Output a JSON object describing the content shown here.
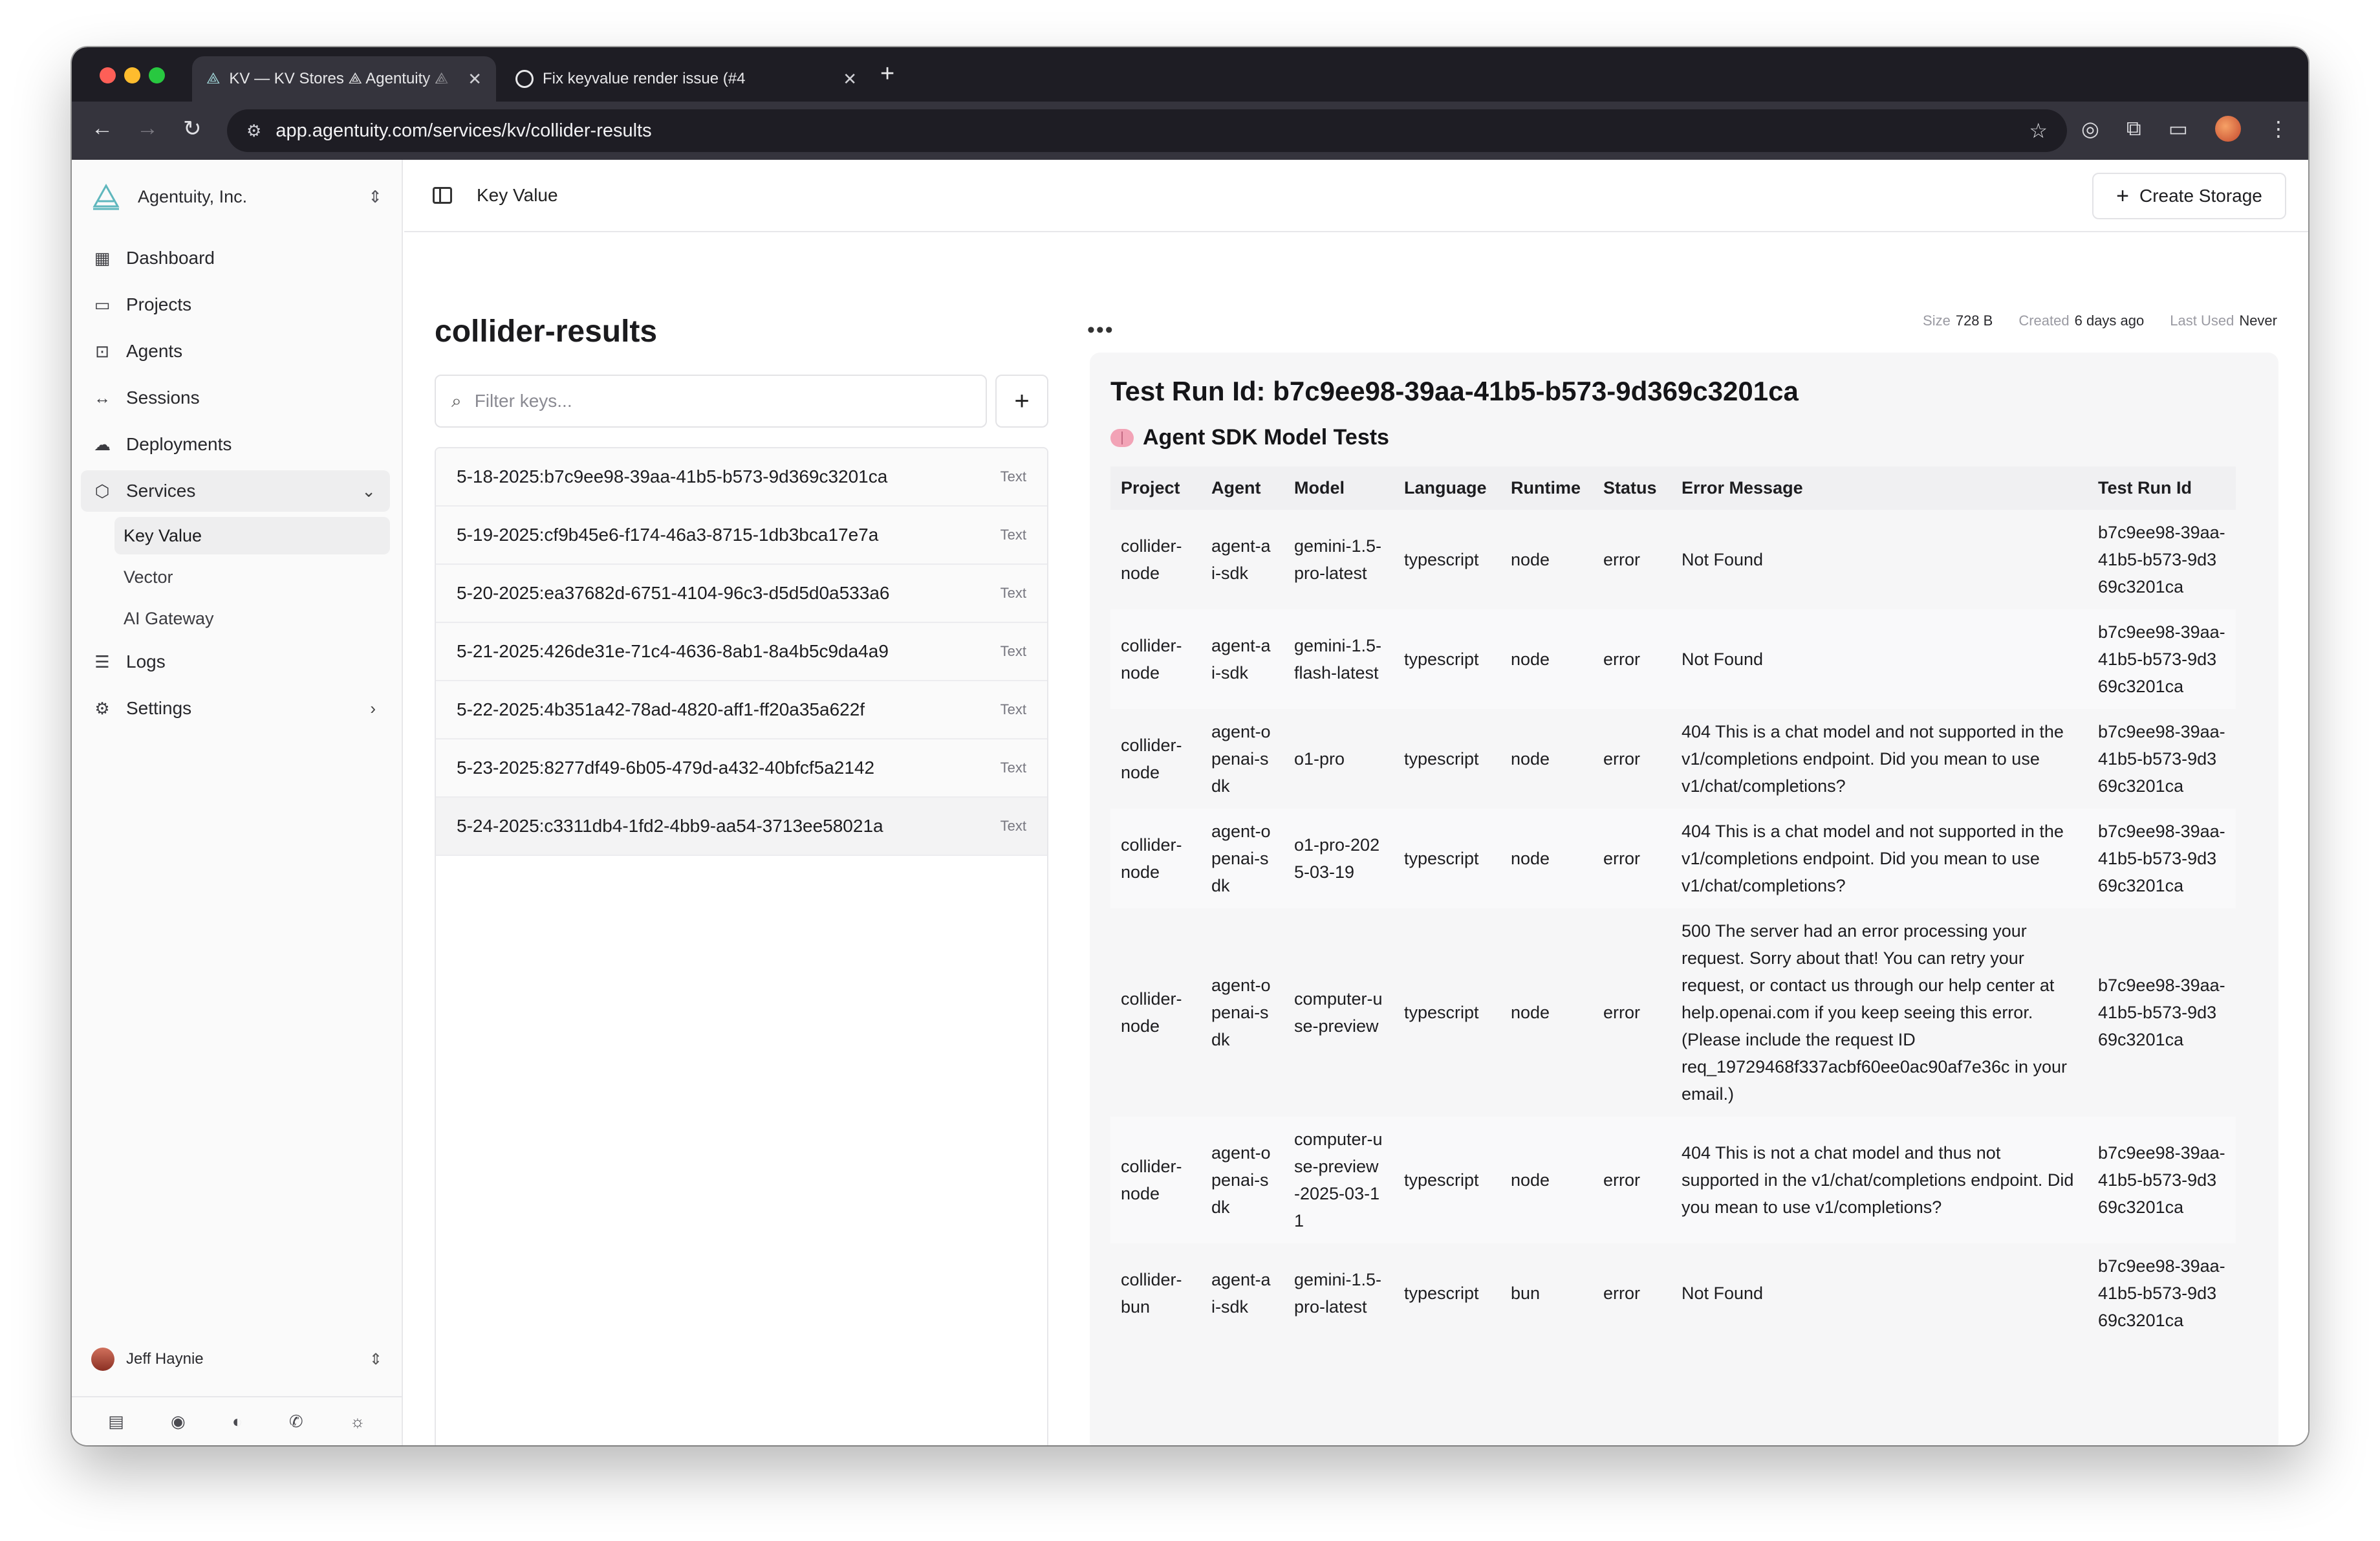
{
  "browser": {
    "tabs": [
      {
        "title": "KV — KV Stores ⟁ Agentuity ⟁",
        "active": true
      },
      {
        "title": "Fix keyvalue render issue (#4",
        "active": false
      }
    ],
    "url": "app.agentuity.com/services/kv/collider-results"
  },
  "sidebar": {
    "org_name": "Agentuity, Inc.",
    "items": [
      {
        "label": "Dashboard",
        "icon": "dashboard-icon"
      },
      {
        "label": "Projects",
        "icon": "folder-icon"
      },
      {
        "label": "Agents",
        "icon": "robot-icon"
      },
      {
        "label": "Sessions",
        "icon": "code-arrows-icon"
      },
      {
        "label": "Deployments",
        "icon": "cloud-upload-icon"
      },
      {
        "label": "Services",
        "icon": "package-icon"
      },
      {
        "label": "Logs",
        "icon": "logs-icon"
      },
      {
        "label": "Settings",
        "icon": "gear-icon"
      }
    ],
    "service_sub_items": [
      "Key Value",
      "Vector",
      "AI Gateway"
    ],
    "user_name": "Jeff Haynie"
  },
  "header": {
    "breadcrumb": "Key Value",
    "create_button": "Create Storage"
  },
  "keys": {
    "store_name": "collider-results",
    "filter_placeholder": "Filter keys...",
    "rows": [
      {
        "key": "5-18-2025:b7c9ee98-39aa-41b5-b573-9d369c3201ca",
        "type": "Text"
      },
      {
        "key": "5-19-2025:cf9b45e6-f174-46a3-8715-1db3bca17e7a",
        "type": "Text"
      },
      {
        "key": "5-20-2025:ea37682d-6751-4104-96c3-d5d5d0a533a6",
        "type": "Text"
      },
      {
        "key": "5-21-2025:426de31e-71c4-4636-8ab1-8a4b5c9da4a9",
        "type": "Text"
      },
      {
        "key": "5-22-2025:4b351a42-78ad-4820-aff1-ff20a35a622f",
        "type": "Text"
      },
      {
        "key": "5-23-2025:8277df49-6b05-479d-a432-40bfcf5a2142",
        "type": "Text"
      },
      {
        "key": "5-24-2025:c3311db4-1fd2-4bb9-aa54-3713ee58021a",
        "type": "Text"
      }
    ]
  },
  "meta": {
    "size_label": "Size",
    "size_value": "728 B",
    "created_label": "Created",
    "created_value": "6 days ago",
    "last_used_label": "Last Used",
    "last_used_value": "Never"
  },
  "detail": {
    "title": "Test Run Id: b7c9ee98-39aa-41b5-b573-9d369c3201ca",
    "section_title": "Agent SDK Model Tests",
    "columns": [
      "Project",
      "Agent",
      "Model",
      "Language",
      "Runtime",
      "Status",
      "Error Message",
      "Test Run Id"
    ],
    "rows": [
      [
        "collider-node",
        "agent-ai-sdk",
        "gemini-1.5-pro-latest",
        "typescript",
        "node",
        "error",
        "Not Found",
        "b7c9ee98-39aa-41b5-b573-9d369c3201ca"
      ],
      [
        "collider-node",
        "agent-ai-sdk",
        "gemini-1.5-flash-latest",
        "typescript",
        "node",
        "error",
        "Not Found",
        "b7c9ee98-39aa-41b5-b573-9d369c3201ca"
      ],
      [
        "collider-node",
        "agent-openai-sdk",
        "o1-pro",
        "typescript",
        "node",
        "error",
        "404 This is a chat model and not supported in the v1/completions endpoint. Did you mean to use v1/chat/completions?",
        "b7c9ee98-39aa-41b5-b573-9d369c3201ca"
      ],
      [
        "collider-node",
        "agent-openai-sdk",
        "o1-pro-2025-03-19",
        "typescript",
        "node",
        "error",
        "404 This is a chat model and not supported in the v1/completions endpoint. Did you mean to use v1/chat/completions?",
        "b7c9ee98-39aa-41b5-b573-9d369c3201ca"
      ],
      [
        "collider-node",
        "agent-openai-sdk",
        "computer-use-preview",
        "typescript",
        "node",
        "error",
        "500 The server had an error processing your request. Sorry about that! You can retry your request, or contact us through our help center at help.openai.com if you keep seeing this error. (Please include the request ID req_19729468f337acbf60ee0ac90af7e36c in your email.)",
        "b7c9ee98-39aa-41b5-b573-9d369c3201ca"
      ],
      [
        "collider-node",
        "agent-openai-sdk",
        "computer-use-preview-2025-03-11",
        "typescript",
        "node",
        "error",
        "404 This is not a chat model and thus not supported in the v1/chat/completions endpoint. Did you mean to use v1/completions?",
        "b7c9ee98-39aa-41b5-b573-9d369c3201ca"
      ],
      [
        "collider-bun",
        "agent-ai-sdk",
        "gemini-1.5-pro-latest",
        "typescript",
        "bun",
        "error",
        "Not Found",
        "b7c9ee98-39aa-41b5-b573-9d369c3201ca"
      ]
    ]
  }
}
